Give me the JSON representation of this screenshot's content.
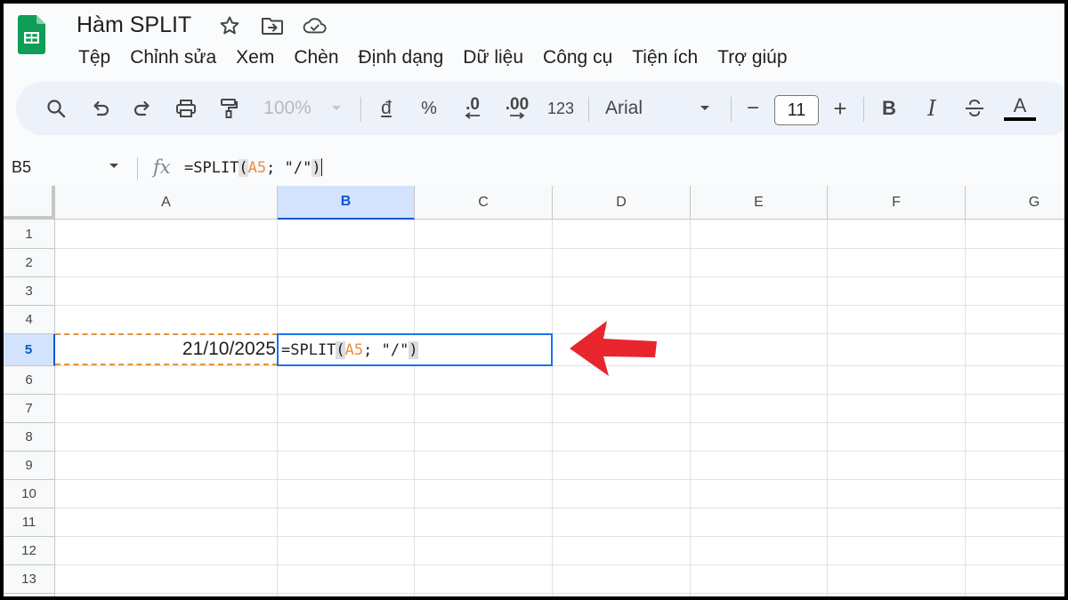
{
  "app": {
    "doc_title": "Hàm SPLIT",
    "icons": [
      "star-icon",
      "move-to-folder-icon",
      "cloud-saved-icon"
    ]
  },
  "menu": {
    "items": [
      "Tệp",
      "Chỉnh sửa",
      "Xem",
      "Chèn",
      "Định dạng",
      "Dữ liệu",
      "Công cụ",
      "Tiện ích",
      "Trợ giúp"
    ]
  },
  "toolbar": {
    "zoom": "100%",
    "currency": "đ",
    "percent": "%",
    "decrease_decimal": ".0",
    "increase_decimal": ".00",
    "number_format": "123",
    "font": "Arial",
    "font_size": "11",
    "minus": "−",
    "plus": "+",
    "bold": "B",
    "italic": "I",
    "text_color_label": "A"
  },
  "formula_bar": {
    "name_box": "B5",
    "fx": "fx",
    "formula_prefix": "=SPLIT",
    "paren_open": "(",
    "ref": "A5",
    "formula_rest": "; \"/\"",
    "paren_close": ")"
  },
  "grid": {
    "columns": [
      "A",
      "B",
      "C",
      "D",
      "E",
      "F",
      "G"
    ],
    "selected_column": "B",
    "rows": [
      "1",
      "2",
      "3",
      "4",
      "5",
      "6",
      "7",
      "8",
      "9",
      "10",
      "11",
      "12",
      "13"
    ],
    "selected_row": "5",
    "cells": {
      "A5": "21/10/2025",
      "B5_prefix": "=SPLIT",
      "B5_paren_open": "(",
      "B5_ref": "A5",
      "B5_rest": "; \"/\"",
      "B5_paren_close": ")"
    }
  },
  "colors": {
    "sheets_green": "#0f9d58",
    "selection_blue": "#1a73e8",
    "ref_orange": "#e69138",
    "arrow_red": "#e8262d"
  }
}
